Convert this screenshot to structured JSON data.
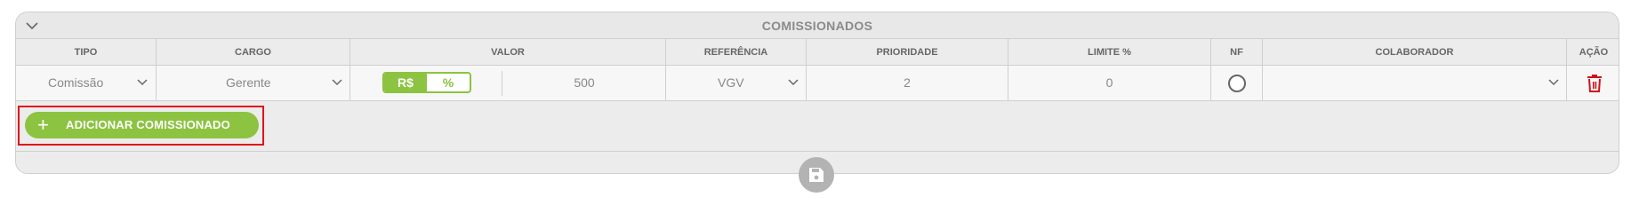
{
  "panel": {
    "title": "COMISSIONADOS"
  },
  "columns": [
    "TIPO",
    "CARGO",
    "VALOR",
    "REFERÊNCIA",
    "PRIORIDADE",
    "LIMITE %",
    "NF",
    "COLABORADOR",
    "AÇÃO"
  ],
  "row": {
    "tipo": "Comissão",
    "cargo": "Gerente",
    "valor_toggle": {
      "option_a": "R$",
      "option_b": "%",
      "selected": "R$"
    },
    "valor": "500",
    "referencia": "VGV",
    "prioridade": "2",
    "limite": "0",
    "nf_checked": false,
    "colaborador": ""
  },
  "add_button": {
    "label": "ADICIONAR COMISSIONADO",
    "icon": "plus-icon"
  },
  "colors": {
    "accent": "#8cc341",
    "delete": "#d0121b",
    "highlight": "#e0141b"
  }
}
